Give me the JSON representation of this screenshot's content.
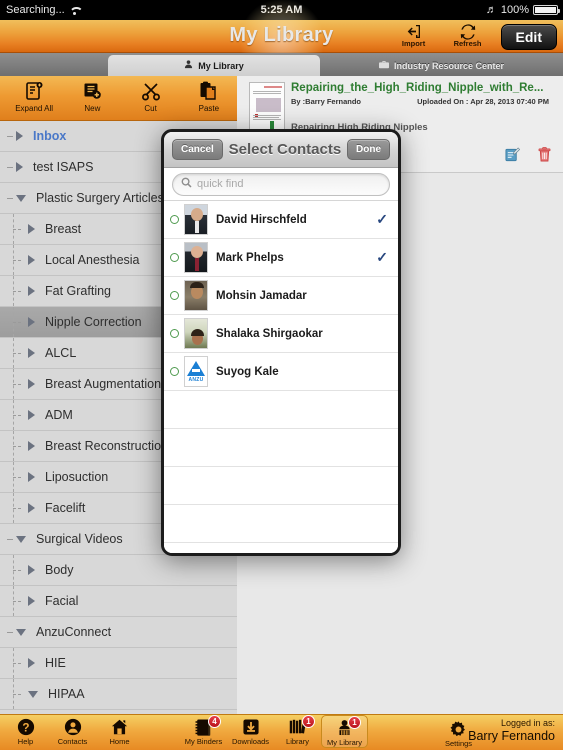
{
  "statusbar": {
    "carrier": "Searching...",
    "wifi_icon": "wifi-icon",
    "time": "5:25 AM",
    "bluetooth_icon": "bluetooth-icon",
    "battery_percent": "100%"
  },
  "header": {
    "title": "My Library",
    "import_label": "Import",
    "import_icon": "import-icon",
    "refresh_label": "Refresh",
    "refresh_icon": "refresh-icon",
    "edit_label": "Edit"
  },
  "tabs": [
    {
      "label": "My Library",
      "icon": "library-tab-icon",
      "active": true
    },
    {
      "label": "Industry Resource Center",
      "icon": "briefcase-icon",
      "active": false
    }
  ],
  "sidebar": {
    "toolbar": [
      {
        "label": "Expand All",
        "icon": "expand-all-icon"
      },
      {
        "label": "New",
        "icon": "new-folder-icon"
      },
      {
        "label": "Cut",
        "icon": "scissors-icon"
      },
      {
        "label": "Paste",
        "icon": "clipboard-paste-icon"
      }
    ],
    "tree": [
      {
        "label": "Inbox",
        "level": 0,
        "expanded": false,
        "selected": false,
        "highlight": true
      },
      {
        "label": "test ISAPS",
        "level": 0,
        "expanded": false,
        "selected": false,
        "highlight": false
      },
      {
        "label": "Plastic Surgery Articles",
        "level": 0,
        "expanded": true,
        "selected": false,
        "highlight": false
      },
      {
        "label": "Breast",
        "level": 1,
        "expanded": false,
        "selected": false,
        "highlight": false
      },
      {
        "label": "Local Anesthesia",
        "level": 1,
        "expanded": false,
        "selected": false,
        "highlight": false
      },
      {
        "label": "Fat Grafting",
        "level": 1,
        "expanded": false,
        "selected": false,
        "highlight": false
      },
      {
        "label": "Nipple Correction",
        "level": 1,
        "expanded": false,
        "selected": true,
        "highlight": false
      },
      {
        "label": "ALCL",
        "level": 1,
        "expanded": false,
        "selected": false,
        "highlight": false
      },
      {
        "label": "Breast Augmentation",
        "level": 1,
        "expanded": false,
        "selected": false,
        "highlight": false
      },
      {
        "label": "ADM",
        "level": 1,
        "expanded": false,
        "selected": false,
        "highlight": false
      },
      {
        "label": "Breast Reconstruction",
        "level": 1,
        "expanded": false,
        "selected": false,
        "highlight": false
      },
      {
        "label": "Liposuction",
        "level": 1,
        "expanded": false,
        "selected": false,
        "highlight": false
      },
      {
        "label": "Facelift",
        "level": 1,
        "expanded": false,
        "selected": false,
        "highlight": false
      },
      {
        "label": "Surgical Videos",
        "level": 0,
        "expanded": true,
        "selected": false,
        "highlight": false
      },
      {
        "label": "Body",
        "level": 1,
        "expanded": false,
        "selected": false,
        "highlight": false
      },
      {
        "label": "Facial",
        "level": 1,
        "expanded": false,
        "selected": false,
        "highlight": false
      },
      {
        "label": "AnzuConnect",
        "level": 0,
        "expanded": true,
        "selected": false,
        "highlight": false
      },
      {
        "label": "HIE",
        "level": 1,
        "expanded": false,
        "selected": false,
        "highlight": false
      },
      {
        "label": "HIPAA",
        "level": 1,
        "expanded": true,
        "selected": false,
        "highlight": false
      }
    ]
  },
  "document": {
    "title": "Repairing_the_High_Riding_Nipple_with_Re...",
    "author": "By :Barry Fernando",
    "uploaded": "Uploaded On : Apr 28, 2013 07:40 PM",
    "subtitle": "Repairing High Riding Nipples",
    "edit_icon": "note-edit-icon",
    "delete_icon": "trash-icon"
  },
  "modal": {
    "cancel_label": "Cancel",
    "title": "Select Contacts",
    "done_label": "Done",
    "search_placeholder": "quick find",
    "search_icon": "search-icon",
    "search_value": "",
    "contacts": [
      {
        "name": "David Hirschfeld",
        "avatar": "face-a",
        "selected": true
      },
      {
        "name": "Mark Phelps",
        "avatar": "face-b",
        "selected": true
      },
      {
        "name": "Mohsin Jamadar",
        "avatar": "face-c",
        "selected": false
      },
      {
        "name": "Shalaka Shirgaokar",
        "avatar": "face-d",
        "selected": false
      },
      {
        "name": "Suyog Kale",
        "avatar": "anzu",
        "selected": false
      }
    ],
    "checkmark": "✓",
    "anzu_label": "ANZU"
  },
  "bottombar": {
    "left": [
      {
        "label": "Help",
        "icon": "help-icon",
        "badge": null,
        "selected": false
      },
      {
        "label": "Contacts",
        "icon": "contacts-icon",
        "badge": null,
        "selected": false
      },
      {
        "label": "Home",
        "icon": "home-icon",
        "badge": null,
        "selected": false
      }
    ],
    "center": [
      {
        "label": "My Binders",
        "icon": "binder-icon",
        "badge": "4",
        "selected": false
      },
      {
        "label": "Downloads",
        "icon": "download-icon",
        "badge": null,
        "selected": false
      },
      {
        "label": "Library",
        "icon": "books-icon",
        "badge": "1",
        "selected": false
      },
      {
        "label": "My Library",
        "icon": "my-library-icon",
        "badge": "1",
        "selected": true
      }
    ],
    "settings": {
      "label": "Settings",
      "icon": "gear-icon"
    },
    "logged_in_label": "Logged in as:",
    "user_name": "Barry Fernando"
  },
  "colors": {
    "accent_orange": "#e87f22",
    "doc_title_green": "#2f7d32",
    "check_blue": "#28477f",
    "badge_red": "#c01820",
    "inbox_blue": "#4a78c8"
  }
}
